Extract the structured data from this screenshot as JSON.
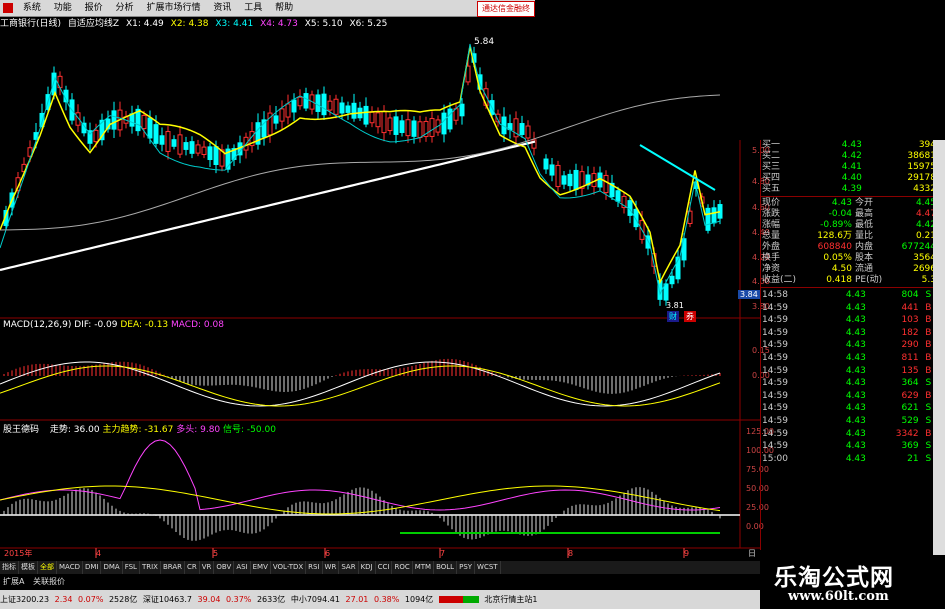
{
  "menu": {
    "items": [
      "系统",
      "功能",
      "报价",
      "分析",
      "扩展市场行情",
      "资讯",
      "工具",
      "帮助"
    ],
    "promo": "通达信金融终"
  },
  "header": {
    "stock_name": "工商银行(日线)",
    "indicator": "自适应均线Z",
    "ma_values": [
      {
        "label": "X1: 4.49",
        "color": "#ffffff"
      },
      {
        "label": "X2: 4.38",
        "color": "#ffff00"
      },
      {
        "label": "X3: 4.41",
        "color": "#00ffff"
      },
      {
        "label": "X4: 4.73",
        "color": "#ff44ff"
      },
      {
        "label": "X5: 5.10",
        "color": "#ffffff"
      },
      {
        "label": "X6: 5.25",
        "color": "#ffffff"
      }
    ]
  },
  "main_chart": {
    "high_label": "5.84",
    "low_label": "3.81",
    "price_axis": [
      "5.00",
      "4.80",
      "4.60",
      "4.40",
      "4.20",
      "4.00",
      "3.80"
    ],
    "current_price_tag": "3.84",
    "marker_cai": "财",
    "marker_quan": "券"
  },
  "macd": {
    "title": "MACD(12,26,9)",
    "dif": "DIF: -0.09",
    "dea": "DEA: -0.13",
    "macd": "MACD: 0.08",
    "axis": [
      "0.15",
      "0.00"
    ]
  },
  "gs": {
    "title": "股王德码",
    "zoushi": "走势: 36.00",
    "main_trend": "主力趋势: -31.67",
    "duotou": "多头: 9.80",
    "xinhao": "信号: -50.00",
    "axis": [
      "125.00",
      "100.00",
      "75.00",
      "50.00",
      "25.00",
      "0.00"
    ]
  },
  "date_axis": {
    "year": "2015年",
    "months": [
      "4",
      "5",
      "6",
      "7",
      "8",
      "9"
    ],
    "right_label": "日"
  },
  "bottom_tabs": [
    "指标",
    "模板",
    "全部",
    "MACD",
    "DMI",
    "DMA",
    "FSL",
    "TRIX",
    "BRAR",
    "CR",
    "VR",
    "OBV",
    "ASI",
    "EMV",
    "VOL-TDX",
    "RSI",
    "WR",
    "SAR",
    "KDJ",
    "CCI",
    "ROC",
    "MTM",
    "BOLL",
    "PSY",
    "WCST"
  ],
  "bottom_tabs2": [
    "扩展A",
    "关联报价"
  ],
  "quote": {
    "bids": [
      {
        "label": "买一",
        "price": "4.43",
        "vol": "394"
      },
      {
        "label": "买二",
        "price": "4.42",
        "vol": "38681"
      },
      {
        "label": "买三",
        "price": "4.41",
        "vol": "15975"
      },
      {
        "label": "买四",
        "price": "4.40",
        "vol": "29178"
      },
      {
        "label": "买五",
        "price": "4.39",
        "vol": "4332"
      }
    ],
    "stats": [
      {
        "l1": "现价",
        "v1": "4.43",
        "l2": "今开",
        "v2": "4.45"
      },
      {
        "l1": "涨跌",
        "v1": "-0.04",
        "l2": "最高",
        "v2": "4.47"
      },
      {
        "l1": "涨幅",
        "v1": "-0.89%",
        "l2": "最低",
        "v2": "4.42"
      },
      {
        "l1": "总量",
        "v1": "128.6万",
        "l2": "量比",
        "v2": "0.21"
      },
      {
        "l1": "外盘",
        "v1": "608840",
        "l2": "内盘",
        "v2": "677244"
      },
      {
        "l1": "换手",
        "v1": "0.05%",
        "l2": "股本",
        "v2": "3564"
      },
      {
        "l1": "净资",
        "v1": "4.50",
        "l2": "流通",
        "v2": "2696"
      },
      {
        "l1": "收益(二)",
        "v1": "0.418",
        "l2": "PE(动)",
        "v2": "5.3"
      }
    ],
    "ticks": [
      {
        "t": "14:58",
        "p": "4.43",
        "v": "804",
        "s": "S"
      },
      {
        "t": "14:59",
        "p": "4.43",
        "v": "441",
        "s": "B"
      },
      {
        "t": "14:59",
        "p": "4.43",
        "v": "103",
        "s": "B"
      },
      {
        "t": "14:59",
        "p": "4.43",
        "v": "182",
        "s": "B"
      },
      {
        "t": "14:59",
        "p": "4.43",
        "v": "290",
        "s": "B"
      },
      {
        "t": "14:59",
        "p": "4.43",
        "v": "811",
        "s": "B"
      },
      {
        "t": "14:59",
        "p": "4.43",
        "v": "135",
        "s": "B"
      },
      {
        "t": "14:59",
        "p": "4.43",
        "v": "364",
        "s": "S"
      },
      {
        "t": "14:59",
        "p": "4.43",
        "v": "629",
        "s": "B"
      },
      {
        "t": "14:59",
        "p": "4.43",
        "v": "621",
        "s": "S"
      },
      {
        "t": "14:59",
        "p": "4.43",
        "v": "529",
        "s": "S"
      },
      {
        "t": "14:59",
        "p": "4.43",
        "v": "3342",
        "s": "B"
      },
      {
        "t": "14:59",
        "p": "4.43",
        "v": "369",
        "s": "S"
      },
      {
        "t": "15:00",
        "p": "4.43",
        "v": "21",
        "s": "S"
      }
    ]
  },
  "status_bar": {
    "sh": "上证3200.23",
    "sh_chg": "2.34",
    "sh_pct": "0.07%",
    "sh_amt": "2528亿",
    "sz": "深证10463.7",
    "sz_chg": "39.04",
    "sz_pct": "0.37%",
    "sz_amt": "2633亿",
    "zx": "中小7094.41",
    "zx_chg": "27.01",
    "zx_pct": "0.38%",
    "zx_amt": "1094亿",
    "server": "北京行情主站1"
  },
  "brand": {
    "name": "乐淘公式网",
    "url": "www.60lt.com"
  },
  "colors": {
    "up": "#ff3030",
    "down": "#00ffff",
    "grid": "#8b0000",
    "accent_yellow": "#ffff00"
  }
}
